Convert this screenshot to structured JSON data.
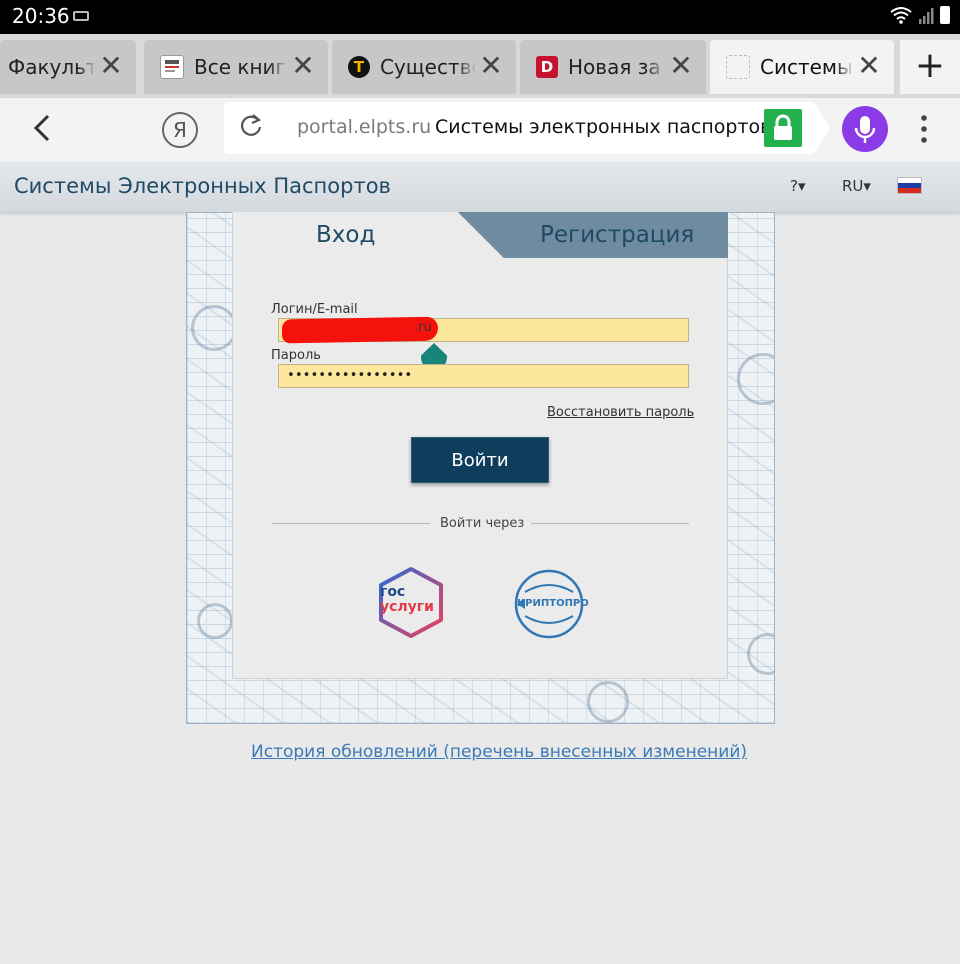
{
  "status_bar": {
    "time": "20:36"
  },
  "tabs": [
    {
      "title": "Факульте",
      "favicon": "scroll"
    },
    {
      "title": "Все книги",
      "favicon": "book-cover"
    },
    {
      "title": "Существо",
      "favicon": "T",
      "favicon_color": "#f2b400"
    },
    {
      "title": "Новая за",
      "favicon": "D",
      "favicon_color": "#c4122f"
    },
    {
      "title": "Системы",
      "favicon": "blank",
      "active": true
    }
  ],
  "address_bar": {
    "domain": "portal.elpts.ru",
    "page_title": "Системы электронных паспортов",
    "yandex_glyph": "Я",
    "lock_color": "#22b14c",
    "mic_color": "#8a3ae6"
  },
  "site_header": {
    "title": "Системы Электронных Паспортов",
    "help": "?▾",
    "language": "RU▾"
  },
  "login_form": {
    "tab_login": "Вход",
    "tab_register": "Регистрация",
    "login_label": "Логин/E-mail",
    "login_suffix": ".ru",
    "password_label": "Пароль",
    "password_value": "••••••••••••••••",
    "restore_link": "Восстановить пароль",
    "submit": "Войти",
    "login_via": "Войти через",
    "providers": [
      {
        "name": "gosuslugi",
        "line1": "гос",
        "line2": "услуги"
      },
      {
        "name": "cryptopro",
        "label": "КРИПТОПРО"
      }
    ]
  },
  "footer_link": "История обновлений (перечень внесенных изменений)",
  "colors": {
    "brand": "#1f4a66",
    "button": "#0f3d5c",
    "input_fill": "#fde79c",
    "link": "#3a7ab8"
  }
}
